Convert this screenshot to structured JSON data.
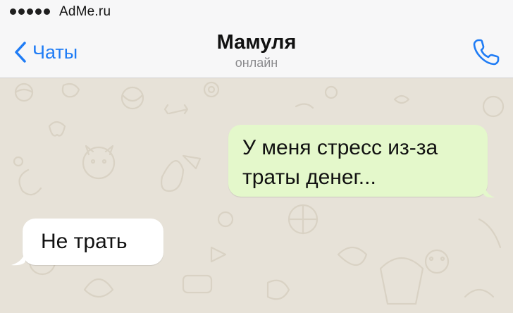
{
  "status_bar": {
    "signal_dots": 5,
    "carrier": "AdMe.ru"
  },
  "nav": {
    "back_label": "Чаты",
    "title": "Мамуля",
    "subtitle": "онлайн",
    "back_icon": "chevron-left-icon",
    "call_icon": "phone-icon"
  },
  "messages": [
    {
      "direction": "outgoing",
      "text": "У меня стресс из-за траты денег..."
    },
    {
      "direction": "incoming",
      "text": "Не трать"
    }
  ],
  "colors": {
    "accent": "#1f7cf5",
    "outgoing_bubble": "#e4f8cb",
    "incoming_bubble": "#ffffff",
    "chat_background": "#e7e2d8"
  }
}
